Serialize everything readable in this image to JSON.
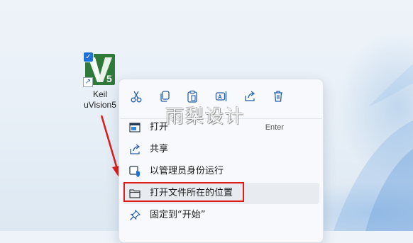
{
  "desktop": {
    "icon_label_line1": "Keil",
    "icon_label_line2": "uVision5",
    "icon_badge": "5",
    "icon_colors": {
      "tile": "#2f7a3a",
      "tile_dark": "#1e5e2b"
    }
  },
  "watermark": {
    "text": "雨梨设计"
  },
  "context_menu": {
    "toolbar": [
      {
        "icon": "cut-icon"
      },
      {
        "icon": "copy-icon"
      },
      {
        "icon": "paste-icon"
      },
      {
        "icon": "rename-icon"
      },
      {
        "icon": "share-icon"
      },
      {
        "icon": "delete-icon"
      }
    ],
    "items": [
      {
        "label": "打开",
        "shortcut": "Enter",
        "icon": "open-app-icon"
      },
      {
        "label": "共享",
        "icon": "share-icon"
      },
      {
        "label": "以管理员身份运行",
        "icon": "admin-shield-icon"
      },
      {
        "label": "打开文件所在的位置",
        "icon": "folder-icon",
        "highlighted": true
      },
      {
        "label": "固定到“开始”",
        "icon": "pin-icon"
      }
    ]
  },
  "colors": {
    "accent": "#1f6fd6",
    "annotation_red": "#e01b1b"
  }
}
